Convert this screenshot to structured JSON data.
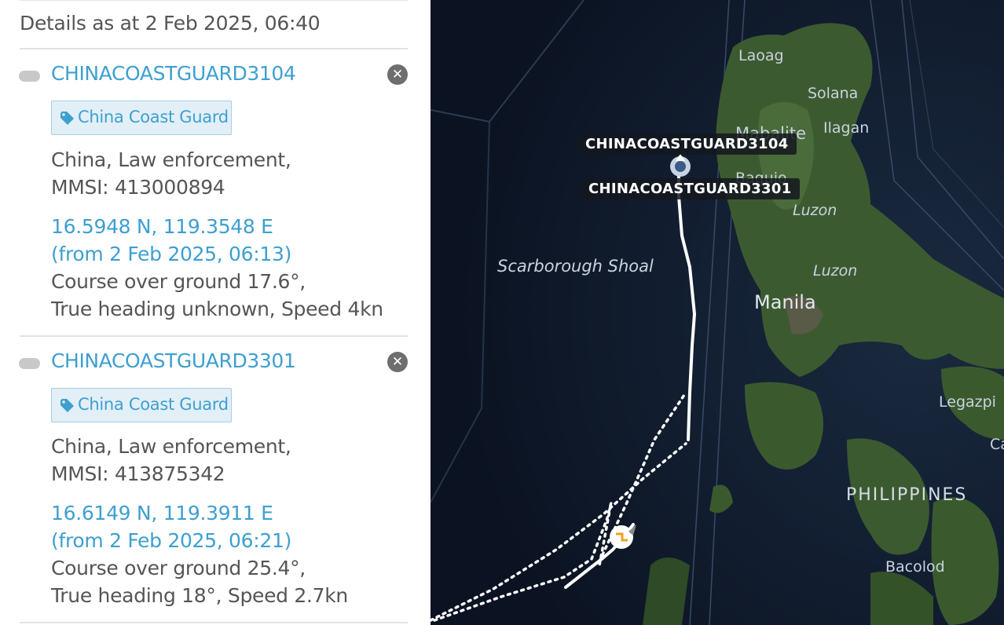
{
  "panel": {
    "details_as_at": "Details as at 2 Feb 2025, 06:40",
    "vessels": [
      {
        "name": "CHINACOASTGUARD3104",
        "tag": "China Coast Guard",
        "info_line1": "China, Law enforcement,",
        "info_line2": "MMSI: 413000894",
        "position": "16.5948 N, 119.3548 E",
        "position_time": "(from 2 Feb 2025, 06:13)",
        "course": "Course over ground 17.6°,",
        "heading_speed": "True heading unknown, Speed 4kn"
      },
      {
        "name": "CHINACOASTGUARD3301",
        "tag": "China Coast Guard",
        "info_line1": "China, Law enforcement,",
        "info_line2": "MMSI: 413875342",
        "position": "16.6149 N, 119.3911 E",
        "position_time": "(from 2 Feb 2025, 06:21)",
        "course": "Course over ground 25.4°,",
        "heading_speed": "True heading 18°, Speed 2.7kn"
      }
    ]
  },
  "map": {
    "place_labels": {
      "laoag": "Laoag",
      "solana": "Solana",
      "mabalite": "Mabalite",
      "ilagan": "Ilagan",
      "baguio": "Baguio",
      "luzon1": "Luzon",
      "luzon2": "Luzon",
      "scarborough": "Scarborough Shoal",
      "manila": "Manila",
      "legazpi": "Legazpi",
      "ca": "Ca",
      "philippines": "PHILIPPINES",
      "bacolod": "Bacolod"
    },
    "ship_labels": {
      "ship1": "CHINACOASTGUARD3104",
      "ship2": "CHINACOASTGUARD3301"
    }
  },
  "icons": {
    "tag": "tag-icon",
    "close": "close-icon",
    "vessel_status": "vessel-status-pill",
    "ship_marker": "ship-marker-icon",
    "track_marker": "track-end-marker-icon"
  },
  "colors": {
    "link_blue": "#3e9fd0",
    "text_gray": "#555555",
    "tag_bg": "#e2eff7",
    "track": "#ffffff",
    "marker_orange": "#f0a020"
  }
}
